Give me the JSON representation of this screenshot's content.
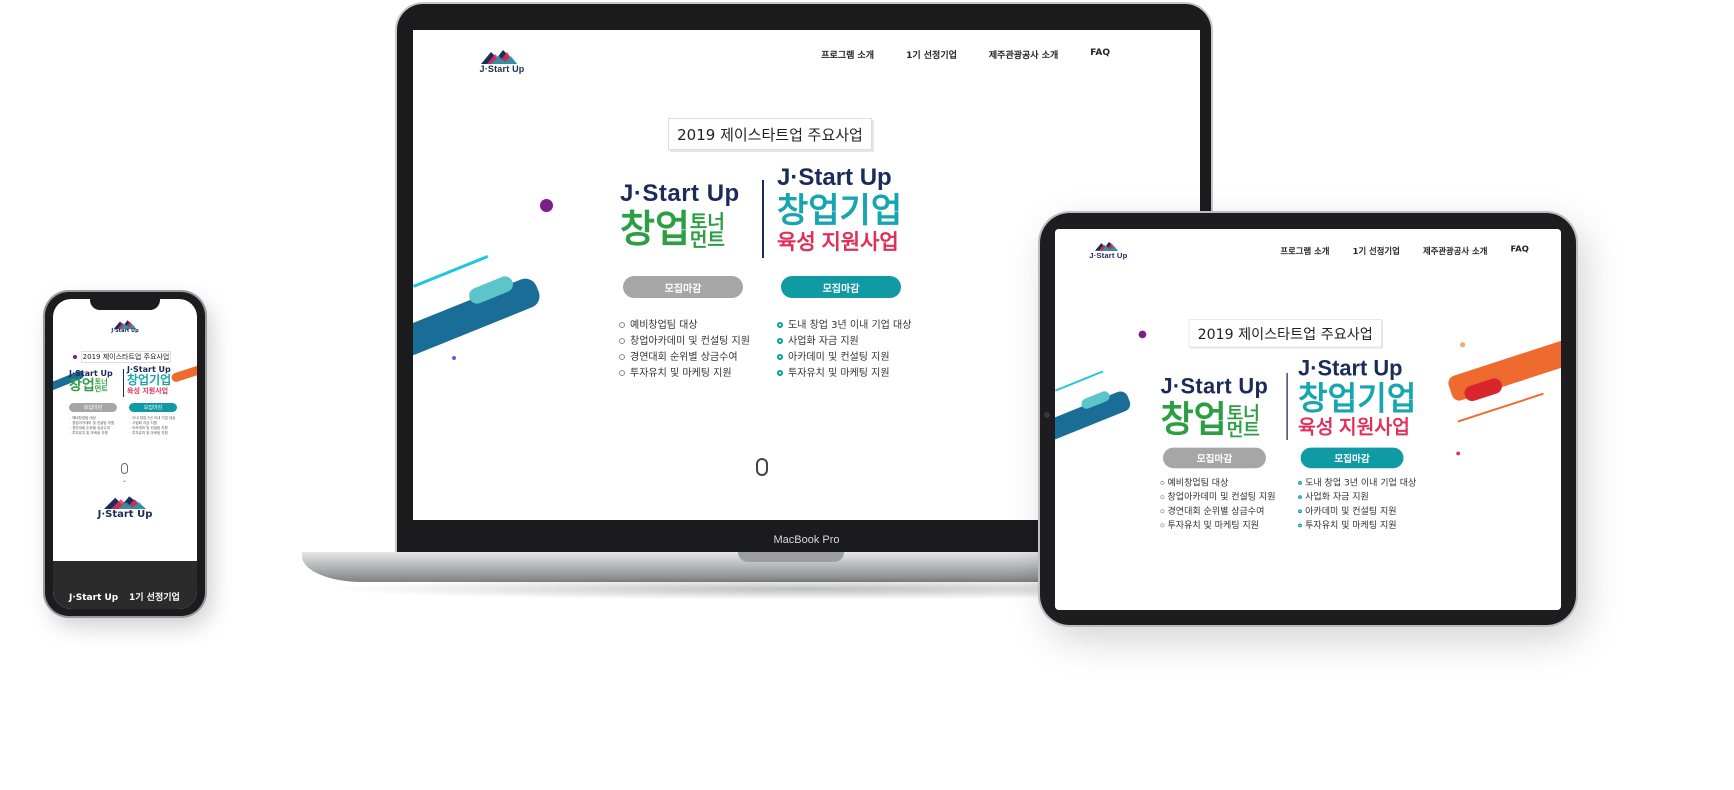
{
  "site": {
    "logo_text": "J·Start Up",
    "nav": [
      "프로그램 소개",
      "1기 선정기업",
      "제주관광공사 소개",
      "FAQ"
    ],
    "year_title": "2019 제이스타트업 주요사업",
    "left": {
      "brand_en": "J·Start Up",
      "brand_ko": "창업",
      "brand_ko_small_1": "토너",
      "brand_ko_small_2": "먼트",
      "button": "모집마감",
      "items": [
        "예비창업팀 대상",
        "창업아카데미 및 컨설팅 지원",
        "경연대회 순위별 상금수여",
        "투자유치 및 마케팅 지원"
      ]
    },
    "right": {
      "brand_en": "J·Start Up",
      "brand_ko": "창업기업",
      "brand_ko2": "육성 지원사업",
      "button": "모집마감",
      "items": [
        "도내 창업 3년 이내 기업 대상",
        "사업화 자금 지원",
        "아카데미 및 컨설팅 지원",
        "투자유치 및 마케팅 지원"
      ]
    },
    "colors": {
      "navy": "#1b2b5a",
      "green": "#2e9e45",
      "teal": "#0f9aa4",
      "pink": "#e0305a",
      "orange": "#ef6a2e",
      "gray_button": "#a6a6a6"
    }
  },
  "laptop": {
    "brand_label": "MacBook Pro"
  },
  "phone": {
    "footer_logo": "J·Start Up",
    "footer_link": "1기 선정기업"
  }
}
